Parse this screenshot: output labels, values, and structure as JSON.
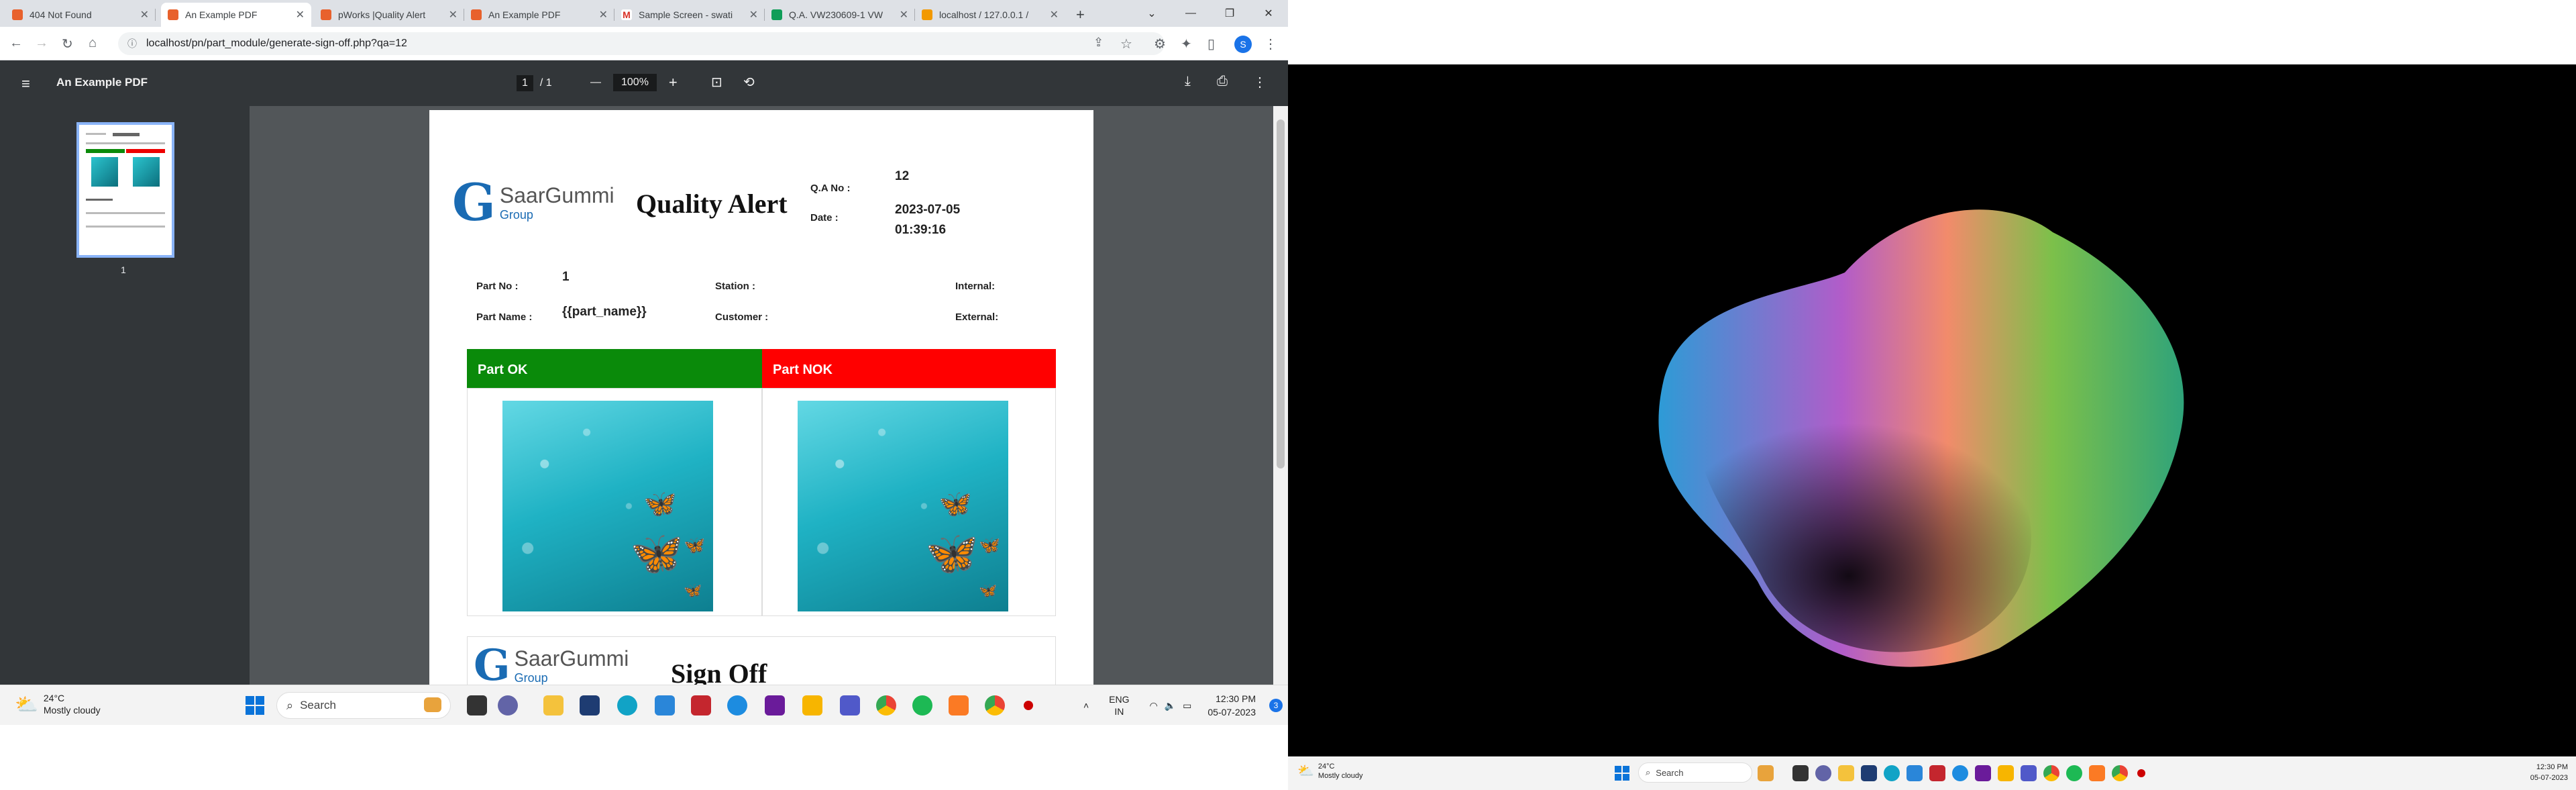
{
  "browser": {
    "tabs": [
      {
        "title": "404 Not Found",
        "color": "#e8612c"
      },
      {
        "title": "An Example PDF",
        "color": "#e8612c"
      },
      {
        "title": "pWorks |Quality Alert",
        "color": "#e8612c"
      },
      {
        "title": "An Example PDF",
        "color": "#e8612c"
      },
      {
        "title": "Sample Screen - swati",
        "color": "#d93025"
      },
      {
        "title": "Q.A. VW230609-1 VW",
        "color": "#0f9d58"
      },
      {
        "title": "localhost / 127.0.0.1 /",
        "color": "#f29900"
      }
    ],
    "active_tab": 1,
    "new_tab_label": "+",
    "url": "localhost/pn/part_module/generate-sign-off.php?qa=12",
    "profile_initial": "S"
  },
  "pdf_viewer": {
    "title": "An Example PDF",
    "page_current": "1",
    "page_total": "/  1",
    "zoom": "100%",
    "thumb_label": "1"
  },
  "document": {
    "logo": {
      "name": "SaarGummi",
      "group": "Group"
    },
    "title": "Quality Alert",
    "qa_no_label": "Q.A No :",
    "qa_no": "12",
    "date_label": "Date :",
    "date": "2023-07-05",
    "time": "01:39:16",
    "part_no_label": "Part No :",
    "part_no": "1",
    "part_name_label": "Part Name :",
    "part_name": "{{part_name}}",
    "station_label": "Station :",
    "customer_label": "Customer :",
    "internal_label": "Internal:",
    "external_label": "External:",
    "part_ok": "Part OK",
    "part_nok": "Part NOK",
    "sign_off": "Sign Off"
  },
  "taskbar": {
    "temperature": "24°C",
    "weather": "Mostly cloudy",
    "search": "Search",
    "lang": "ENG",
    "region": "IN",
    "time": "12:30 PM",
    "date": "05-07-2023",
    "notification_count": "3"
  },
  "colors": {
    "ok_green": "#0a8a0a",
    "nok_red": "#ff0000",
    "pdf_toolbar": "#323639",
    "pdf_bg": "#525659"
  }
}
